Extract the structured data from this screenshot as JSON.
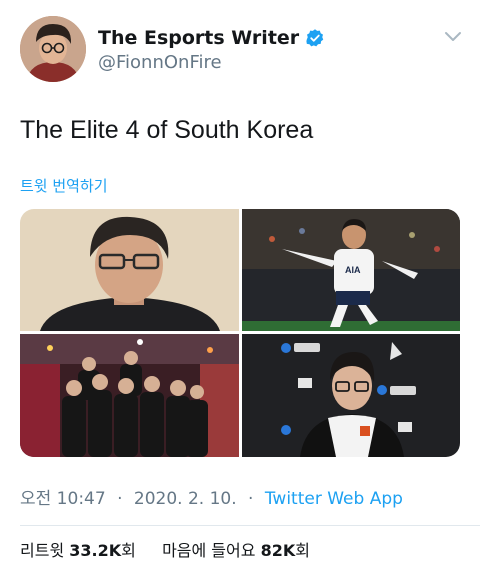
{
  "author": {
    "display_name": "The Esports Writer",
    "handle": "@FionnOnFire",
    "verified": true
  },
  "tweet": {
    "text": "The Elite 4 of South Korea",
    "translate_label": "트윗 번역하기"
  },
  "media": [
    {
      "name": "media-photo-1",
      "icon": "portrait-photo"
    },
    {
      "name": "media-photo-2",
      "icon": "football-player-photo"
    },
    {
      "name": "media-photo-3",
      "icon": "group-photo"
    },
    {
      "name": "media-photo-4",
      "icon": "esports-player-photo"
    }
  ],
  "meta": {
    "time": "오전 10:47",
    "sep1": "·",
    "date": "2020. 2. 10.",
    "sep2": "·",
    "source": "Twitter Web App"
  },
  "stats": {
    "retweets_label": "리트윗",
    "retweets_count": "33.2K",
    "retweets_suffix": "회",
    "likes_label": "마음에 들어요",
    "likes_count": "82K",
    "likes_suffix": "회"
  },
  "colors": {
    "accent": "#1da1f2",
    "text": "#14171a",
    "muted": "#657786"
  }
}
